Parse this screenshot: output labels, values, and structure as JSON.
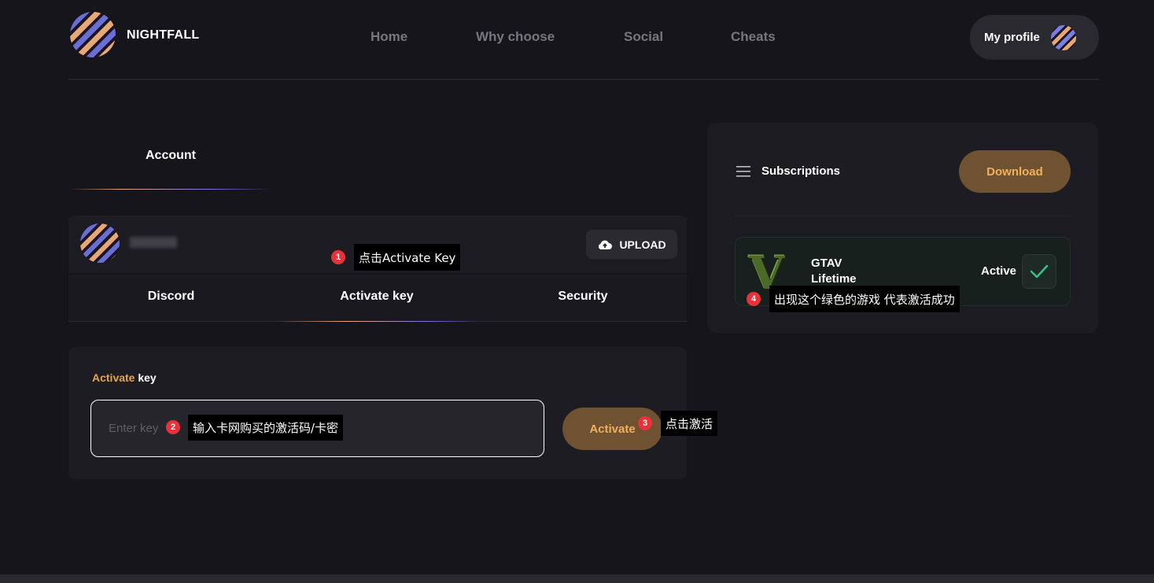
{
  "header": {
    "brand": "NIGHTFALL",
    "nav": [
      "Home",
      "Why choose",
      "Social",
      "Cheats"
    ],
    "profile_label": "My profile"
  },
  "account": {
    "title": "Account",
    "upload_label": "UPLOAD",
    "tabs": [
      "Discord",
      "Activate key",
      "Security"
    ],
    "active_tab": "Activate key"
  },
  "activate": {
    "title_accent": "Activate",
    "title_rest": " key",
    "placeholder": "Enter key",
    "button_label": "Activate"
  },
  "subscriptions": {
    "title": "Subscriptions",
    "download_label": "Download",
    "items": [
      {
        "logo": "V",
        "name": "GTAV",
        "plan": "Lifetime",
        "status": "Active"
      }
    ]
  },
  "annotations": [
    {
      "num": "1",
      "text": "点击Activate Key"
    },
    {
      "num": "2",
      "text": "输入卡网购买的激活码/卡密"
    },
    {
      "num": "3",
      "text": "点击激活"
    },
    {
      "num": "4",
      "text": "出现这个绿色的游戏 代表激活成功"
    }
  ],
  "colors": {
    "background": "#16151b",
    "panel": "#1d1c22",
    "accent": "#e8a44a",
    "button_bg": "#6e5232",
    "success": "#2fc88a",
    "badge": "#e8323a"
  },
  "icons": [
    "logo-orb",
    "avatar",
    "cloud-upload-icon",
    "menu-icon",
    "check-icon"
  ]
}
